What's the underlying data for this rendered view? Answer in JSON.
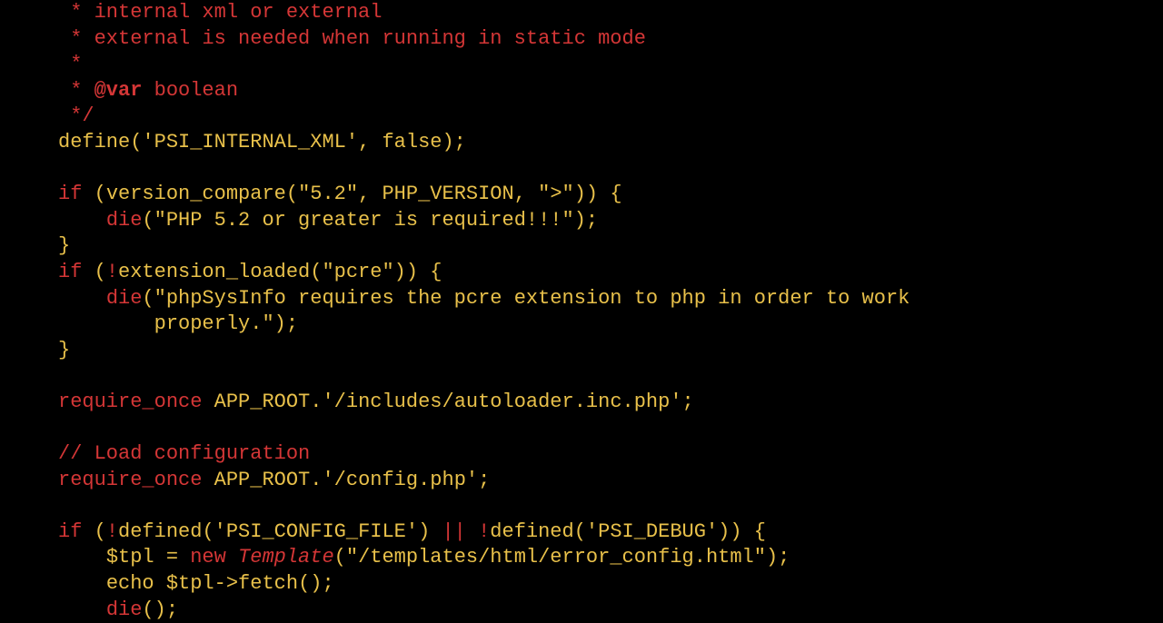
{
  "code": {
    "comment_line1": " * internal xml or external",
    "comment_line2": " * external is needed when running in static mode",
    "comment_line3": " *",
    "comment_line4_star": " * ",
    "comment_line4_tag": "@var",
    "comment_line4_type": " boolean",
    "comment_line5": " */",
    "define_kw": "define",
    "define_open": "(",
    "define_str": "'PSI_INTERNAL_XML'",
    "define_comma": ", ",
    "define_val": "false",
    "define_close": ");",
    "if1_kw": "if",
    "if1_open": " (",
    "if1_func": "version_compare",
    "if1_paren": "(",
    "if1_arg1": "\"5.2\"",
    "if1_c1": ", ",
    "if1_const": "PHP_VERSION",
    "if1_c2": ", ",
    "if1_arg3": "\">\"",
    "if1_close": ")) {",
    "die1_indent": "    ",
    "die1_kw": "die",
    "die1_open": "(",
    "die1_str": "\"PHP 5.2 or greater is required!!!\"",
    "die1_close": ");",
    "if1_end": "}",
    "if2_kw": "if",
    "if2_open": " (",
    "if2_not": "!",
    "if2_func": "extension_loaded",
    "if2_paren": "(",
    "if2_arg": "\"pcre\"",
    "if2_close": ")) {",
    "die2_indent": "    ",
    "die2_kw": "die",
    "die2_open": "(",
    "die2_str1": "\"phpSysInfo requires the pcre extension to php in order to work",
    "die2_str2_indent": "        ",
    "die2_str2": "properly.\"",
    "die2_close": ");",
    "if2_end": "}",
    "req1_kw": "require_once",
    "req1_sp": " ",
    "req1_const": "APP_ROOT",
    "req1_dot": ".",
    "req1_str": "'/includes/autoloader.inc.php'",
    "req1_semi": ";",
    "comment_load": "// Load configuration",
    "req2_kw": "require_once",
    "req2_sp": " ",
    "req2_const": "APP_ROOT",
    "req2_dot": ".",
    "req2_str": "'/config.php'",
    "req2_semi": ";",
    "if3_kw": "if",
    "if3_open": " (",
    "if3_not1": "!",
    "if3_func1": "defined",
    "if3_p1": "(",
    "if3_arg1": "'PSI_CONFIG_FILE'",
    "if3_cp1": ") ",
    "if3_or": "||",
    "if3_sp": " ",
    "if3_not2": "!",
    "if3_func2": "defined",
    "if3_p2": "(",
    "if3_arg2": "'PSI_DEBUG'",
    "if3_close": ")) {",
    "tpl_indent": "    ",
    "tpl_var": "$tpl",
    "tpl_eq": " = ",
    "tpl_new": "new",
    "tpl_sp": " ",
    "tpl_class": "Template",
    "tpl_open": "(",
    "tpl_str": "\"/templates/html/error_config.html\"",
    "tpl_close": ");",
    "echo_indent": "    ",
    "echo_kw": "echo",
    "echo_sp": " ",
    "echo_var": "$tpl",
    "echo_arrow": "->",
    "echo_method": "fetch",
    "echo_close": "();",
    "die3_indent": "    ",
    "die3_kw": "die",
    "die3_close": "();"
  }
}
